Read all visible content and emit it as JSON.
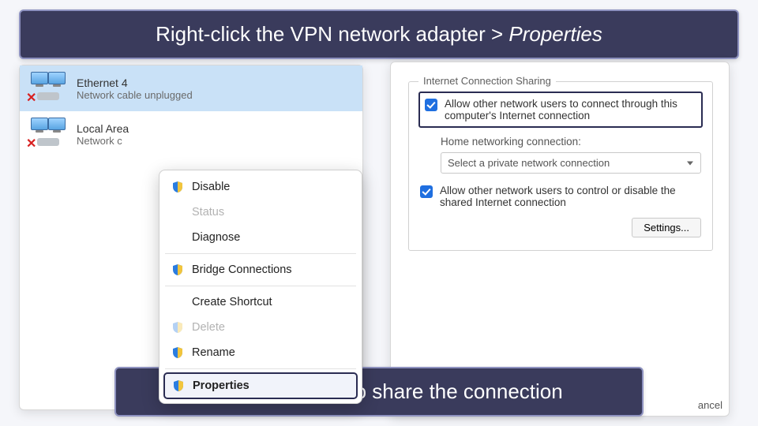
{
  "banners": {
    "top_prefix": "Right-click the VPN network adapter > ",
    "top_emph": "Properties",
    "bottom": "Allow the device to share the connection"
  },
  "adapters": [
    {
      "name": "Ethernet 4",
      "status": "Network cable unplugged"
    },
    {
      "name": "Local Area",
      "status": "Network c"
    }
  ],
  "context_menu": {
    "disable": "Disable",
    "status": "Status",
    "diagnose": "Diagnose",
    "bridge": "Bridge Connections",
    "shortcut": "Create Shortcut",
    "delete": "Delete",
    "rename": "Rename",
    "properties": "Properties"
  },
  "sharing": {
    "legend": "Internet Connection Sharing",
    "allow_connect": "Allow other network users to connect through this computer's Internet connection",
    "home_label": "Home networking connection:",
    "home_value": "Select a private network connection",
    "allow_control": "Allow other network users to control or disable the shared Internet connection",
    "settings_btn": "Settings...",
    "cancel_edge": "ancel"
  }
}
